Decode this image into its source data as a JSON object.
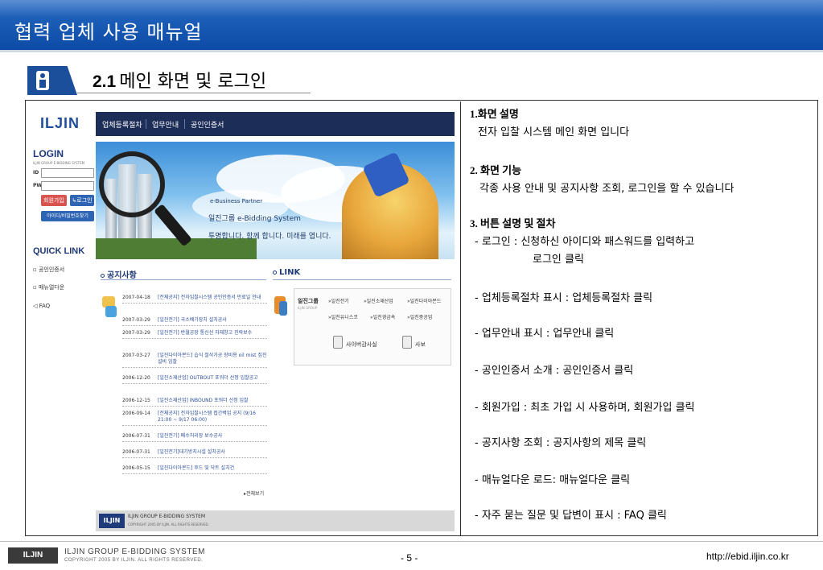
{
  "slide": {
    "title": "협력 업체 사용 매뉴얼",
    "section_num": "2.1",
    "section_title": "메인 화면 및 로그인"
  },
  "screenshot": {
    "logo": "ILJIN",
    "nav": [
      "업체등록절차",
      "업무안내",
      "공인인증서"
    ],
    "login": {
      "title": "LOGIN",
      "subtitle": "ILJIN GROUP E-BIDDING SYSTEM",
      "id_label": "ID",
      "pw_label": "PW",
      "join_button": "회원가입",
      "login_button": "↳로그인",
      "find_button": "아이디/비밀번호찾기"
    },
    "quick_link": {
      "title": "QUICK LINK",
      "items": [
        "공인인증서",
        "매뉴얼다운",
        "FAQ"
      ]
    },
    "banner": {
      "line1": "e-Business Partner",
      "line2": "일진그룹 e-Bidding System",
      "line3": "투명합니다. 함께 합니다. 미래를 엽니다."
    },
    "notice": {
      "title": "공지사항",
      "more": "▸전체보기",
      "rows": [
        {
          "date": "2007-04-18",
          "text": "[전체공지] 전자입찰시스템 공인인증서 만료일 안내"
        },
        {
          "date": "2007-03-29",
          "text": "[일진전기] 국소배기장치 설치공사"
        },
        {
          "date": "2007-03-29",
          "text": "[일진전기] 반월공장 통신선 자재창고 진락보수"
        },
        {
          "date": "2007-03-27",
          "text": "[일진다이아몬드] 습식 절삭가공 장비용 oil mist 집진설비 입찰"
        },
        {
          "date": "2006-12-20",
          "text": "[일진소재산업] OUTBOUT 포워더 선정 입찰공고"
        },
        {
          "date": "2006-12-15",
          "text": "[일진소재산업] INBOUND 포워더 선정 입찰"
        },
        {
          "date": "2006-09-14",
          "text": "[전체공지] 전자입찰시스템 접간벽업 공지 (9/16 21:00 ~ 9/17 06:00)"
        },
        {
          "date": "2006-07-31",
          "text": "[일진전기] 폐수처리장 보수공사"
        },
        {
          "date": "2006-07-31",
          "text": "[일진전기]대기방지시설 설치공사"
        },
        {
          "date": "2006-05-15",
          "text": "[일진다이아몬드] 후드 및 닥트 설치건"
        }
      ]
    },
    "link": {
      "title": "LINK",
      "brand": "일진그룹",
      "brand_sub": "ILJIN GROUP",
      "row1": [
        "»일진전기",
        "»일진소재산업",
        "»일진다이아몬드"
      ],
      "row2": [
        "»일진유니스코",
        "»일진경금속",
        "»일진중공업"
      ],
      "cyber": "사이버감사실",
      "news": "사보"
    },
    "footer": {
      "logo": "ILJIN",
      "line1": "ILJIN GROUP E-BIDDING SYSTEM",
      "line2": "COPYRIGHT 2005 BY ILJIN. ALL RIGHTS RESERVED."
    }
  },
  "description": {
    "h1": "1.화면 설명",
    "p1": "전자 입찰 시스템  메인 화면 입니다",
    "h2": "2. 화면 기능",
    "p2": "각종 사용 안내 및 공지사항 조회, 로그인을 할 수 있습니다",
    "h3": "3. 버튼 설명 및 절차",
    "items": [
      "- 로그인 : 신청하신 아이디와 패스워드를 입력하고",
      "로그인 클릭",
      "- 업체등록절차 표시 : 업체등록절차 클릭",
      "- 업무안내 표시 : 업무안내 클릭",
      "- 공인인증서 소개 : 공인인증서 클릭",
      "- 회원가입 : 최초 가입 시 사용하며, 회원가입 클릭",
      "- 공지사항 조회 : 공지사항의 제목 클릭",
      "- 매뉴얼다운 로드: 매뉴얼다운 클릭",
      "- 자주 묻는 질문 및 답변이 표시 : FAQ 클릭"
    ]
  },
  "footer": {
    "logo": "ILJIN",
    "system": "ILJIN GROUP E-BIDDING SYSTEM",
    "copyright": "COPYRIGHT 2005 BY ILJIN. ALL RIGHTS RESERVED.",
    "page": "- 5 -",
    "url": "http://ebid.iljin.co.kr"
  }
}
